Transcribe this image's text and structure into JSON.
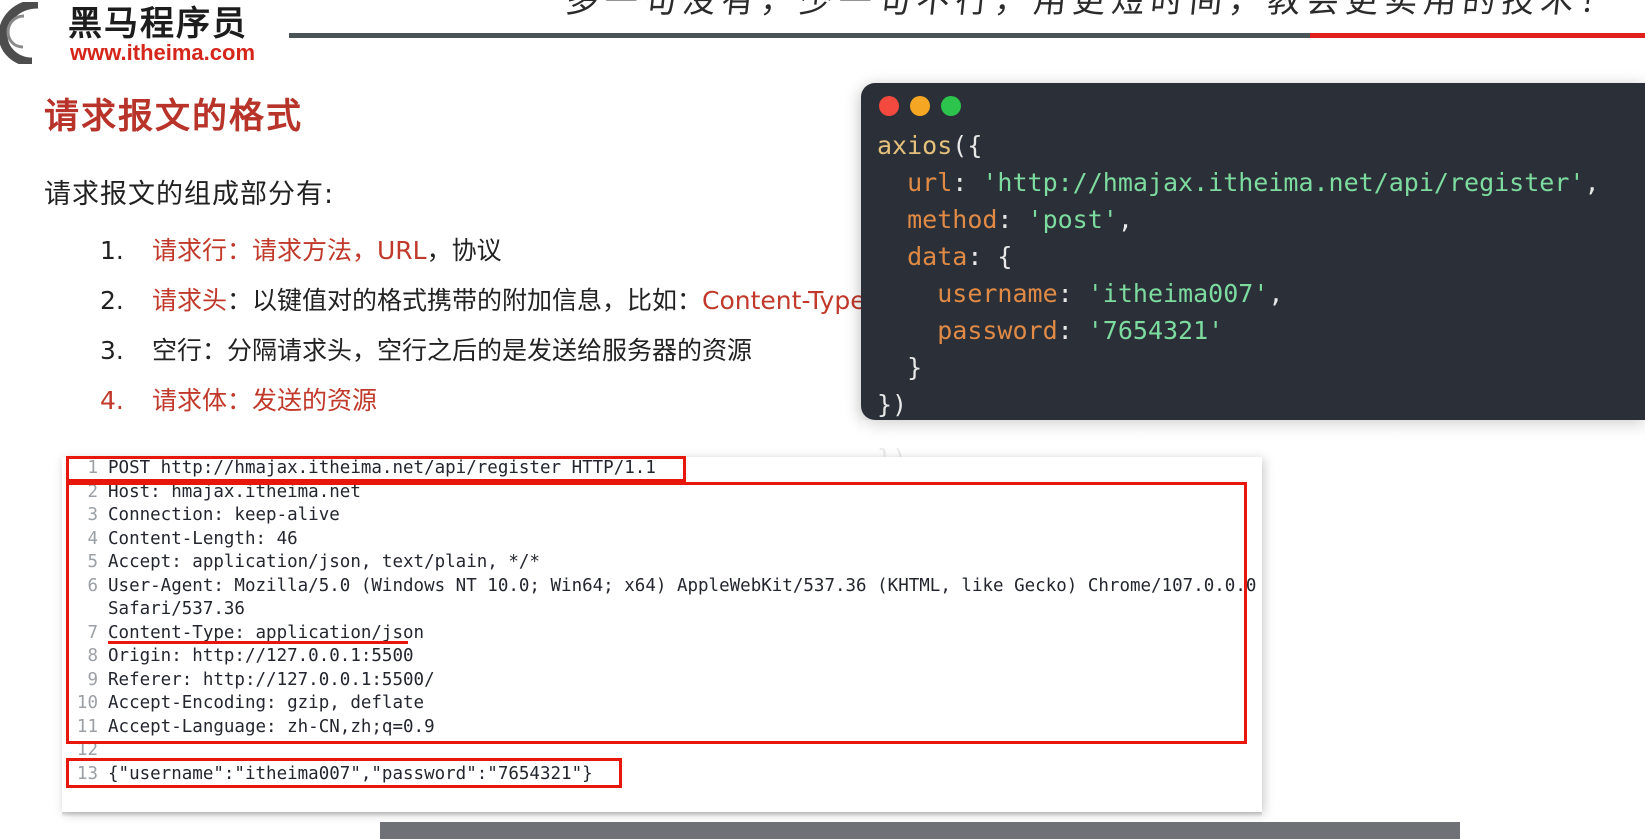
{
  "header": {
    "logo_cn": "黑马程序员",
    "logo_url": "www.itheima.com",
    "slogan": "多一句没有，少一句不行，用更短时间，教会更实用的技术！",
    "divider_dark_color": "#4a5456",
    "divider_red_color": "#e0201b"
  },
  "slide": {
    "title": "请求报文的格式",
    "intro": "请求报文的组成部分有:",
    "title_color": "#b8342a",
    "accent_color": "#c0392b",
    "bullets": [
      {
        "num": "1.",
        "parts": [
          {
            "text": "请求行：请求方法，URL",
            "color": "red"
          },
          {
            "text": "，协议",
            "color": "dark"
          }
        ]
      },
      {
        "num": "2.",
        "parts": [
          {
            "text": "请求头",
            "color": "red"
          },
          {
            "text": "：以键值对的格式携带的附加信息，比如：",
            "color": "dark"
          },
          {
            "text": "Content-Type",
            "color": "red"
          }
        ]
      },
      {
        "num": "3.",
        "parts": [
          {
            "text": "空行：分隔请求头，空行之后的是发送给服务器的资源",
            "color": "dark"
          }
        ]
      },
      {
        "num": "4.",
        "parts": [
          {
            "text": "请求体：发送的资源",
            "color": "red"
          }
        ]
      }
    ]
  },
  "code_card": {
    "traffic_lights": [
      {
        "name": "close",
        "color": "#f4493e"
      },
      {
        "name": "minimize",
        "color": "#f5a623"
      },
      {
        "name": "maximize",
        "color": "#2dc44d"
      }
    ],
    "language": "javascript",
    "lines": [
      [
        {
          "t": "axios",
          "c": "fn"
        },
        {
          "t": "({",
          "c": "pun"
        }
      ],
      [
        {
          "t": "  ",
          "c": "pun"
        },
        {
          "t": "url",
          "c": "key"
        },
        {
          "t": ": ",
          "c": "pun"
        },
        {
          "t": "'http://hmajax.itheima.net/api/register'",
          "c": "str"
        },
        {
          "t": ",",
          "c": "pun"
        }
      ],
      [
        {
          "t": "  ",
          "c": "pun"
        },
        {
          "t": "method",
          "c": "key"
        },
        {
          "t": ": ",
          "c": "pun"
        },
        {
          "t": "'post'",
          "c": "str"
        },
        {
          "t": ",",
          "c": "pun"
        }
      ],
      [
        {
          "t": "  ",
          "c": "pun"
        },
        {
          "t": "data",
          "c": "key"
        },
        {
          "t": ": {",
          "c": "pun"
        }
      ],
      [
        {
          "t": "    ",
          "c": "pun"
        },
        {
          "t": "username",
          "c": "key"
        },
        {
          "t": ": ",
          "c": "pun"
        },
        {
          "t": "'itheima007'",
          "c": "str"
        },
        {
          "t": ",",
          "c": "pun"
        }
      ],
      [
        {
          "t": "    ",
          "c": "pun"
        },
        {
          "t": "password",
          "c": "key"
        },
        {
          "t": ": ",
          "c": "pun"
        },
        {
          "t": "'7654321'",
          "c": "str"
        }
      ],
      [
        {
          "t": "  }",
          "c": "pun"
        }
      ],
      [
        {
          "t": "})",
          "c": "pun"
        }
      ]
    ],
    "reflection_text": "})\n\n  }"
  },
  "http_panel": {
    "rows": [
      {
        "num": "1",
        "text": "POST http://hmajax.itheima.net/api/register HTTP/1.1",
        "continuation": false
      },
      {
        "num": "2",
        "text": "Host: hmajax.itheima.net",
        "continuation": false
      },
      {
        "num": "3",
        "text": "Connection: keep-alive",
        "continuation": false
      },
      {
        "num": "4",
        "text": "Content-Length: 46",
        "continuation": false
      },
      {
        "num": "5",
        "text": "Accept: application/json, text/plain, */*",
        "continuation": false
      },
      {
        "num": "6",
        "text": "User-Agent: Mozilla/5.0 (Windows NT 10.0; Win64; x64) AppleWebKit/537.36 (KHTML, like Gecko) Chrome/107.0.0.0",
        "continuation": false
      },
      {
        "num": "",
        "text": "Safari/537.36",
        "continuation": true
      },
      {
        "num": "7",
        "text": "Content-Type: application/json",
        "continuation": false
      },
      {
        "num": "8",
        "text": "Origin: http://127.0.0.1:5500",
        "continuation": false
      },
      {
        "num": "9",
        "text": "Referer: http://127.0.0.1:5500/",
        "continuation": false
      },
      {
        "num": "10",
        "text": "Accept-Encoding: gzip, deflate",
        "continuation": false
      },
      {
        "num": "11",
        "text": "Accept-Language: zh-CN,zh;q=0.9",
        "continuation": false
      },
      {
        "num": "12",
        "text": "",
        "continuation": false
      },
      {
        "num": "13",
        "text": "{\"username\":\"itheima007\",\"password\":\"7654321\"}",
        "continuation": false
      }
    ],
    "annotation_color": "#e8170b"
  }
}
